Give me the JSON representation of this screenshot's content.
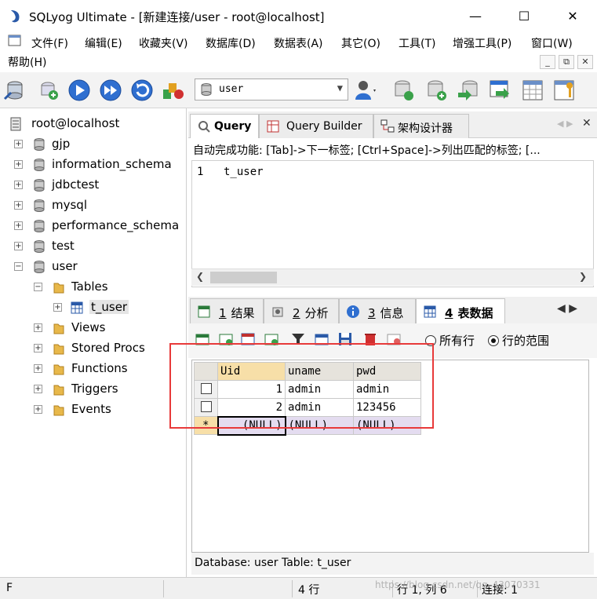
{
  "window": {
    "title": "SQLyog Ultimate - [新建连接/user - root@localhost]",
    "minimize": "—",
    "maximize": "☐",
    "close": "✕"
  },
  "menu": {
    "items": [
      "文件(F)",
      "编辑(E)",
      "收藏夹(V)",
      "数据库(D)",
      "数据表(A)",
      "其它(O)",
      "工具(T)",
      "增强工具(P)",
      "窗口(W)",
      "帮助(H)"
    ],
    "mdi_minimize": "_",
    "mdi_restore": "⧉",
    "mdi_close": "✕"
  },
  "toolbar": {
    "db_selector_value": "user"
  },
  "tree": {
    "root": "root@localhost",
    "databases": [
      "gjp",
      "information_schema",
      "jdbctest",
      "mysql",
      "performance_schema",
      "test",
      "user"
    ],
    "user_children": [
      "Tables",
      "Views",
      "Stored Procs",
      "Functions",
      "Triggers",
      "Events"
    ],
    "tables": [
      "t_user"
    ]
  },
  "query_tabs": [
    "Query",
    "Query Builder",
    "架构设计器"
  ],
  "autocomplete_hint": "自动完成功能: [Tab]->下一标签; [Ctrl+Space]->列出匹配的标签; [...",
  "editor": {
    "line_number": "1",
    "text": "t_user"
  },
  "result_tabs": [
    {
      "num": "1",
      "label": "结果"
    },
    {
      "num": "2",
      "label": "分析"
    },
    {
      "num": "3",
      "label": "信息"
    },
    {
      "num": "4",
      "label": "表数据"
    }
  ],
  "result_options": {
    "all_rows": "所有行",
    "row_range": "行的范围",
    "selected": "行的范围"
  },
  "grid": {
    "columns": [
      "Uid",
      "uname",
      "pwd"
    ],
    "rows": [
      {
        "uid": "1",
        "uname": "admin",
        "pwd": "admin"
      },
      {
        "uid": "2",
        "uname": "admin",
        "pwd": "123456"
      }
    ],
    "new_row_marker": "*",
    "null_text": "(NULL)"
  },
  "status_line": "Database: user  Table: t_user",
  "statusbar": {
    "left": "F",
    "rows": "4 行",
    "position": "行 1, 列 6",
    "connections": "连接: 1"
  },
  "watermark": "https://blog.csdn.net/qq_43070331",
  "colors": {
    "highlight_box": "#e83a3a",
    "sorted_header": "#f7dfa8",
    "new_row": "#e4dcf0"
  }
}
